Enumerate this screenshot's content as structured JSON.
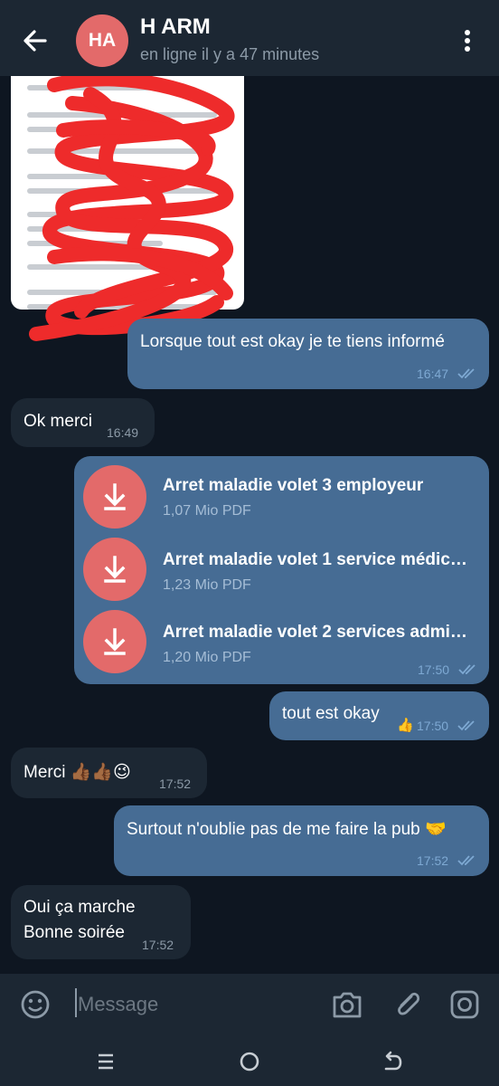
{
  "header": {
    "avatar_initials": "HA",
    "contact_name": "H ARM",
    "status": "en ligne il y a 47 minutes",
    "avatar_color": "#e36a6a"
  },
  "messages": {
    "m1": {
      "text": "Lorsque tout est okay je te tiens informé",
      "time": "16:47"
    },
    "m2": {
      "text": "Ok merci",
      "time": "16:49"
    },
    "files": {
      "time": "17:50",
      "items": [
        {
          "name": "Arret maladie volet 3 employeur",
          "meta": "1,07 Mio PDF"
        },
        {
          "name": "Arret maladie volet 1 service médic…",
          "meta": "1,23 Mio PDF"
        },
        {
          "name": "Arret maladie volet 2 services admi…",
          "meta": "1,20 Mio PDF"
        }
      ]
    },
    "m4": {
      "text": "tout est okay",
      "reaction": "👍",
      "time": "17:50"
    },
    "m5": {
      "text": "Merci 👍🏾👍🏾😉",
      "time": "17:52"
    },
    "m6": {
      "text": "Surtout n'oublie pas de me faire la pub 🤝",
      "time": "17:52"
    },
    "m7": {
      "line1": "Oui ça marche",
      "line2": "Bonne soirée",
      "time": "17:52"
    }
  },
  "input": {
    "placeholder": "Message"
  },
  "icons": {
    "back": "arrow-left-icon",
    "menu": "kebab-menu-icon",
    "download": "download-icon",
    "emoji": "emoji-icon",
    "camera": "camera-icon",
    "attach": "paperclip-icon",
    "instant_camera": "instagram-camera-icon",
    "read": "double-check-icon"
  },
  "colors": {
    "background": "#0e1621",
    "bar": "#1c2733",
    "outgoing_bubble": "#466c94",
    "incoming_bubble": "#1c2733",
    "accent": "#e36a6a",
    "check": "#7ea9d3"
  }
}
